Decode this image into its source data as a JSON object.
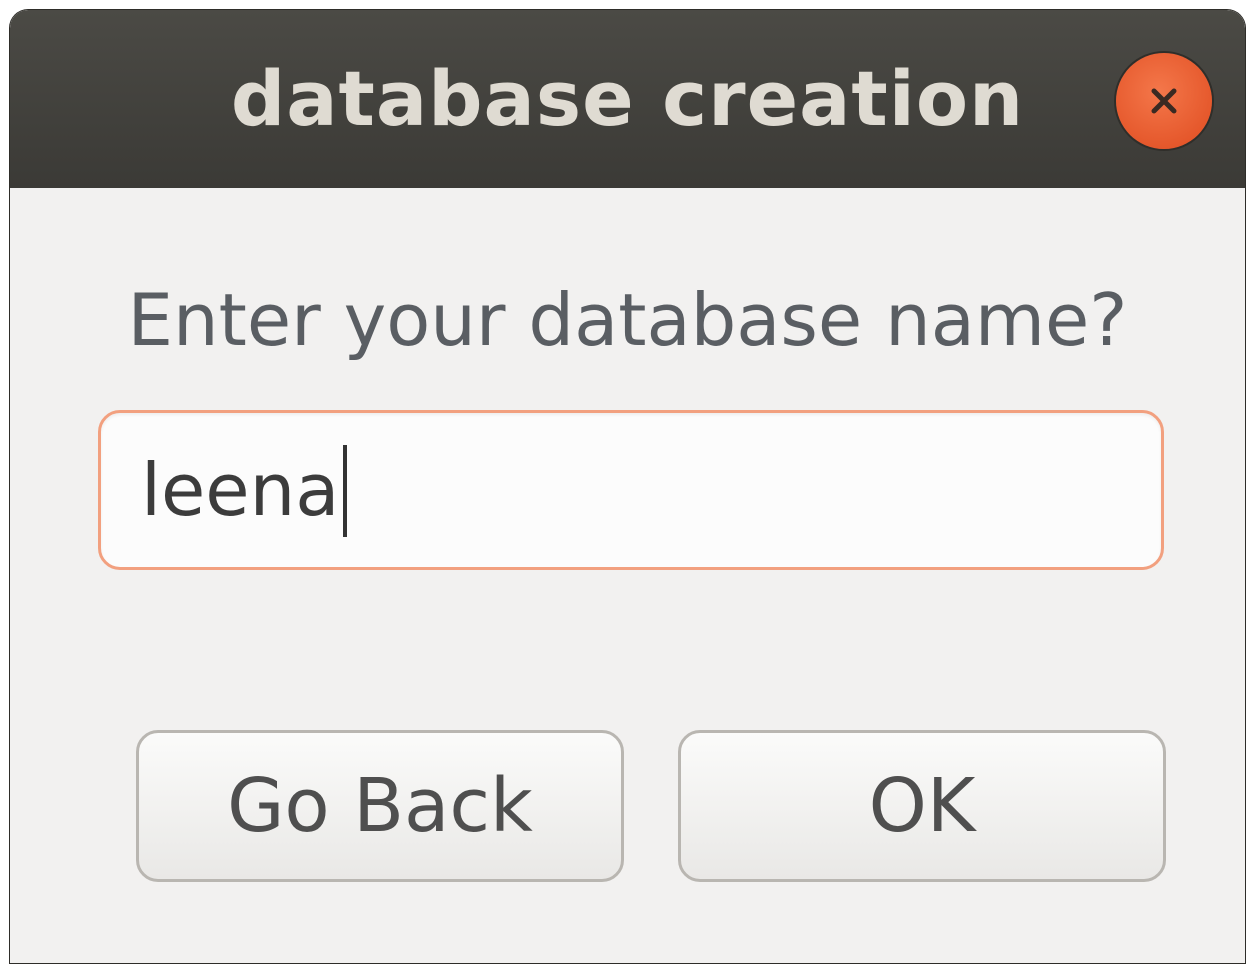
{
  "window": {
    "title": "database creation"
  },
  "dialog": {
    "prompt": "Enter your database name?",
    "input_value": "leena"
  },
  "buttons": {
    "go_back_label": "Go Back",
    "ok_label": "OK"
  },
  "icons": {
    "close": "close-icon"
  },
  "colors": {
    "titlebar": "#3f3e3a",
    "close_button": "#e8552a",
    "input_focus_border": "#f2a07f",
    "background": "#f2f1f0"
  }
}
